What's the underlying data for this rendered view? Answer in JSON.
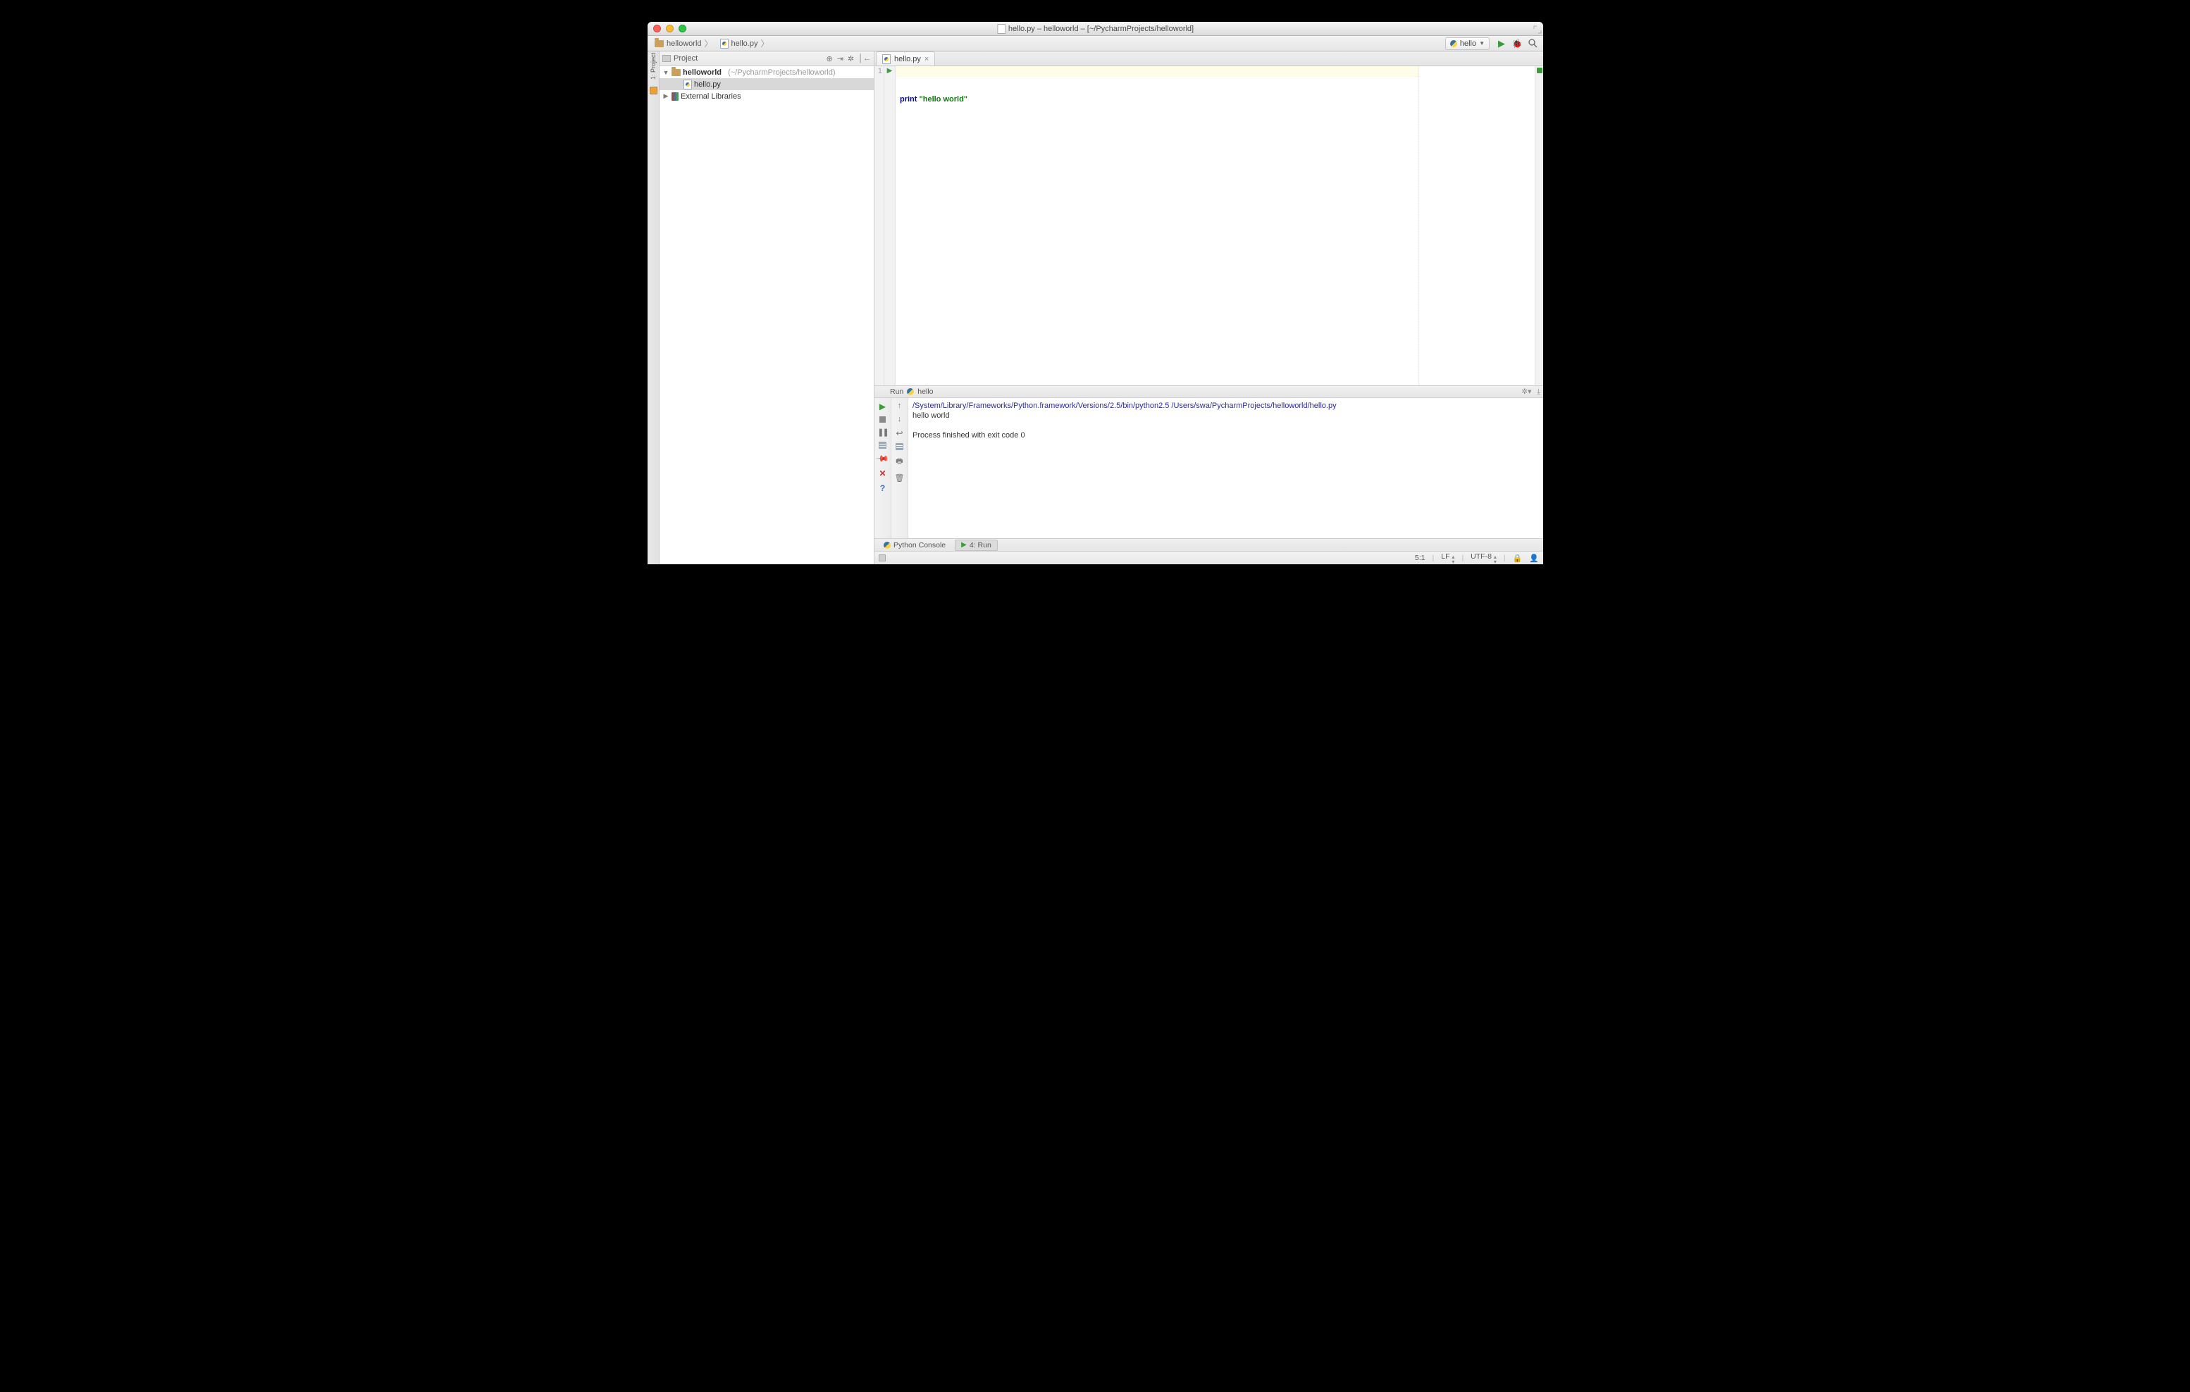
{
  "titlebar": {
    "filename": "hello.py",
    "title": "hello.py – helloworld – [~/PycharmProjects/helloworld]"
  },
  "breadcrumbs": {
    "project": "helloworld",
    "file": "hello.py"
  },
  "run_config": {
    "name": "hello"
  },
  "left_gutter": {
    "label": "1: Project"
  },
  "sidebar": {
    "title": "Project",
    "root": {
      "name": "helloworld",
      "path": "(~/PycharmProjects/helloworld)"
    },
    "file": "hello.py",
    "external": "External Libraries"
  },
  "editor": {
    "tab": "hello.py",
    "line_number": "1",
    "code_keyword": "print",
    "code_string": "\"hello world\""
  },
  "run_header": {
    "label": "Run",
    "config": "hello"
  },
  "console": {
    "cmd": "/System/Library/Frameworks/Python.framework/Versions/2.5/bin/python2.5 /Users/swa/PycharmProjects/helloworld/hello.py",
    "output": "hello world",
    "exit": "Process finished with exit code 0"
  },
  "bottom_tabs": {
    "console": "Python Console",
    "run": "4: Run"
  },
  "status": {
    "pos": "5:1",
    "line_sep": "LF",
    "encoding": "UTF-8"
  }
}
